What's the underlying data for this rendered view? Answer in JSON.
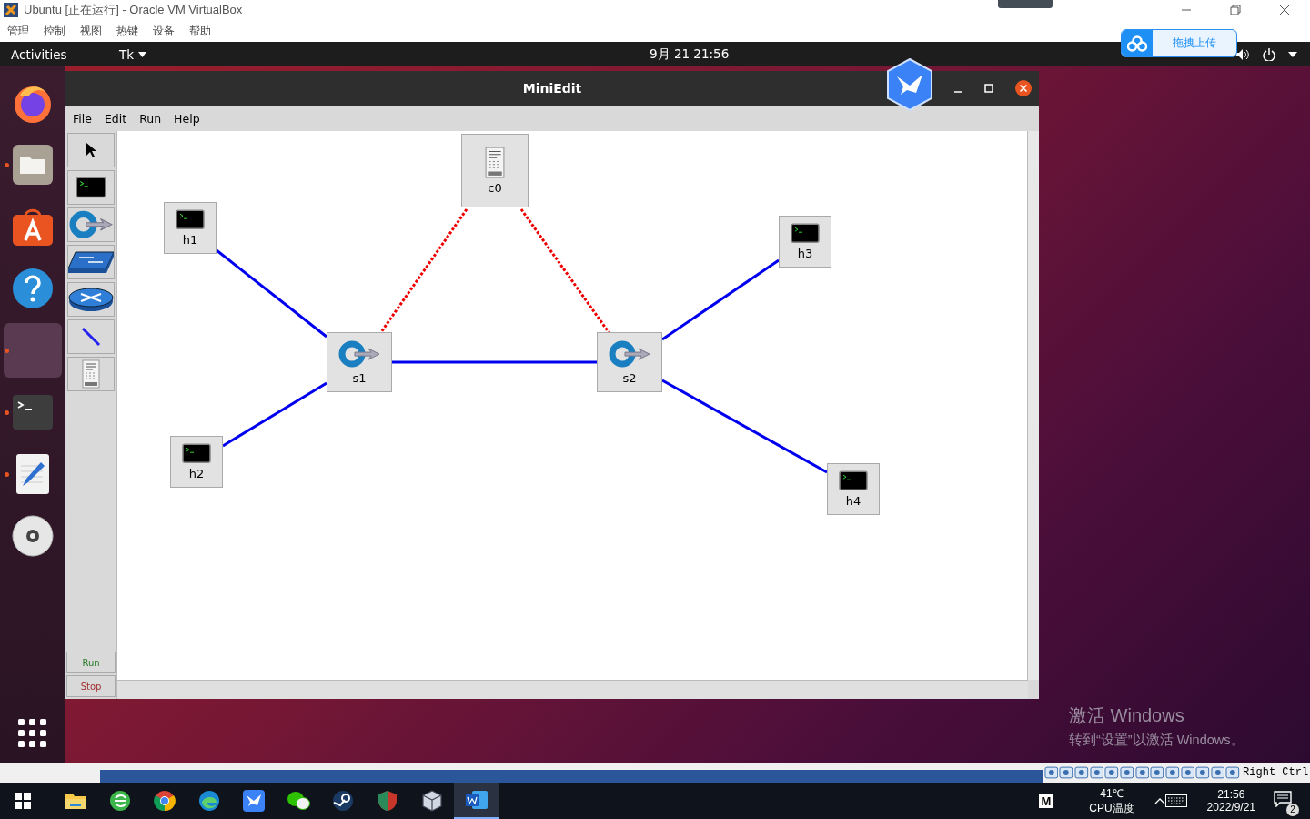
{
  "vbox": {
    "title": "Ubuntu [正在运行] - Oracle VM VirtualBox",
    "menu": [
      "管理",
      "控制",
      "视图",
      "热键",
      "设备",
      "帮助"
    ],
    "host_key": "Right Ctrl"
  },
  "topbar": {
    "activities": "Activities",
    "app_menu": "Tk",
    "clock": "9月 21  21:56"
  },
  "dock": [
    {
      "kind": "firefox",
      "running": false,
      "selected": false
    },
    {
      "kind": "files",
      "running": true,
      "selected": false
    },
    {
      "kind": "software",
      "running": false,
      "selected": false
    },
    {
      "kind": "help",
      "running": false,
      "selected": false
    },
    {
      "kind": "blank",
      "running": true,
      "selected": true
    },
    {
      "kind": "terminal",
      "running": true,
      "selected": false
    },
    {
      "kind": "editor",
      "running": true,
      "selected": false
    },
    {
      "kind": "disc",
      "running": false,
      "selected": false
    }
  ],
  "miniedit": {
    "title": "MiniEdit",
    "menu": [
      "File",
      "Edit",
      "Run",
      "Help"
    ],
    "tools": [
      {
        "kind": "select"
      },
      {
        "kind": "host"
      },
      {
        "kind": "switch"
      },
      {
        "kind": "legacy-switch"
      },
      {
        "kind": "router"
      },
      {
        "kind": "link"
      },
      {
        "kind": "controller"
      }
    ],
    "run": "Run",
    "stop": "Stop",
    "nodes": [
      {
        "kind": "controller",
        "label": "c0"
      },
      {
        "kind": "host",
        "label": "h1"
      },
      {
        "kind": "host",
        "label": "h3"
      },
      {
        "kind": "switch",
        "label": "s1"
      },
      {
        "kind": "switch",
        "label": "s2"
      },
      {
        "kind": "host",
        "label": "h2"
      },
      {
        "kind": "host",
        "label": "h4"
      }
    ],
    "links": [
      {
        "kind": "data"
      },
      {
        "kind": "data"
      },
      {
        "kind": "data"
      },
      {
        "kind": "data"
      },
      {
        "kind": "data"
      },
      {
        "kind": "control"
      },
      {
        "kind": "control"
      }
    ]
  },
  "activation": {
    "title": "激活 Windows",
    "hint": "转到“设置”以激活 Windows。"
  },
  "upload_widget": {
    "label": "拖拽上传"
  },
  "taskbar": {
    "apps": [
      {
        "kind": "explorer",
        "selected": false
      },
      {
        "kind": "ie-browser",
        "selected": false
      },
      {
        "kind": "chrome",
        "selected": false
      },
      {
        "kind": "edge",
        "selected": false
      },
      {
        "kind": "bird",
        "selected": false
      },
      {
        "kind": "chat",
        "selected": false
      },
      {
        "kind": "steam",
        "selected": false
      },
      {
        "kind": "shield",
        "selected": false
      },
      {
        "kind": "virtualbox",
        "selected": false
      },
      {
        "kind": "word",
        "selected": true
      }
    ],
    "tray_app": "M",
    "temperature": "41℃",
    "temperature_label": "CPU温度",
    "time": "21:56",
    "date": "2022/9/21",
    "notifications": "2"
  }
}
